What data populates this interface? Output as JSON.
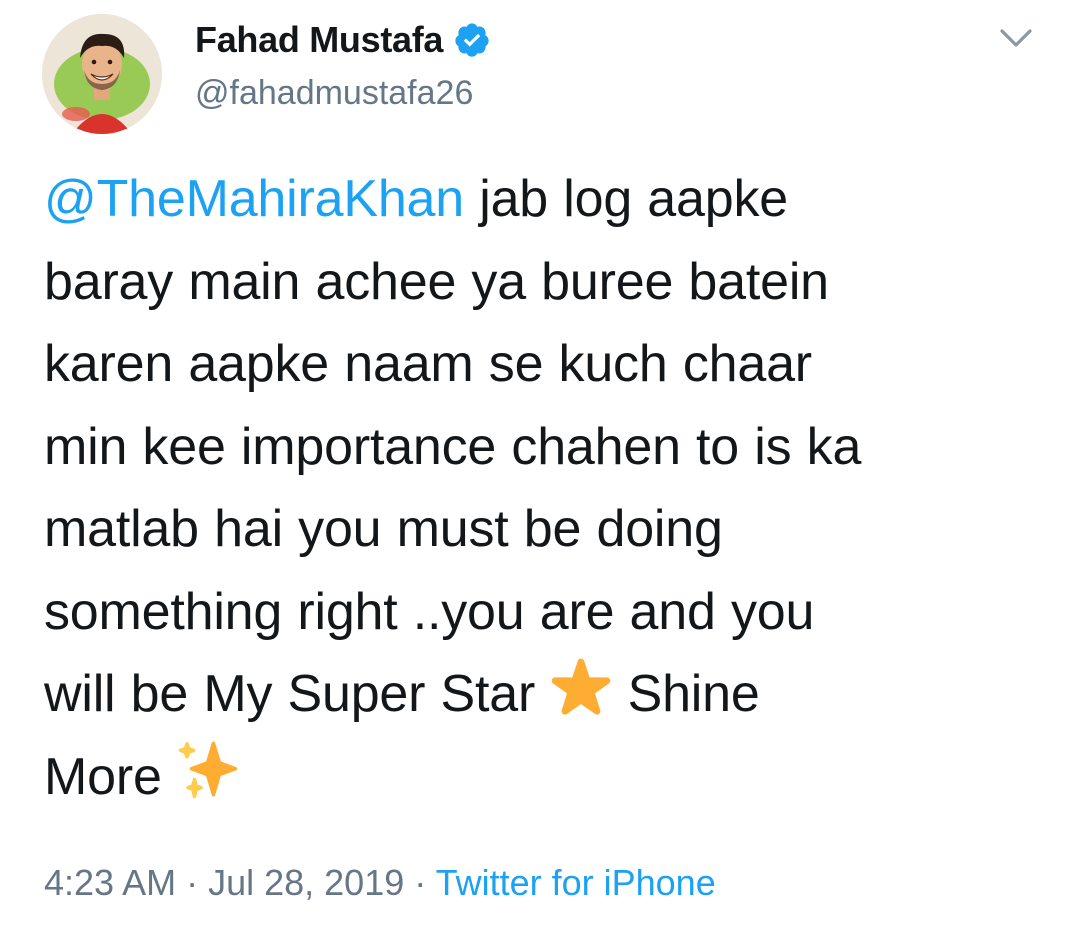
{
  "tweet": {
    "author": {
      "display_name": "Fahad Mustafa",
      "handle": "@fahadmustafa26",
      "verified": true,
      "avatar_icon": "avatar-caricature"
    },
    "menu_icon": "chevron-down-icon",
    "body": {
      "line1_mention": "@TheMahiraKhan",
      "line1_rest": " jab log aapke",
      "line2": "baray main achee ya buree batein",
      "line3": "karen aapke naam se kuch chaar",
      "line4": "min kee importance chahen to is ka",
      "line5": "matlab hai you must be doing",
      "line6": "something right ..you are and you",
      "line7_before_star": "will be My Super Star ",
      "line7_after_star": " Shine",
      "line8": "More "
    },
    "emojis": {
      "star": "star-emoji",
      "sparkles": "sparkles-emoji"
    },
    "meta": {
      "time": "4:23 AM",
      "sep1": " · ",
      "date": "Jul 28, 2019",
      "sep2": " · ",
      "source": "Twitter for iPhone"
    },
    "colors": {
      "link": "#1da1f2",
      "text": "#14171a",
      "muted": "#657786",
      "star": "#f5a623",
      "sparkle": "#fdcb58"
    }
  }
}
